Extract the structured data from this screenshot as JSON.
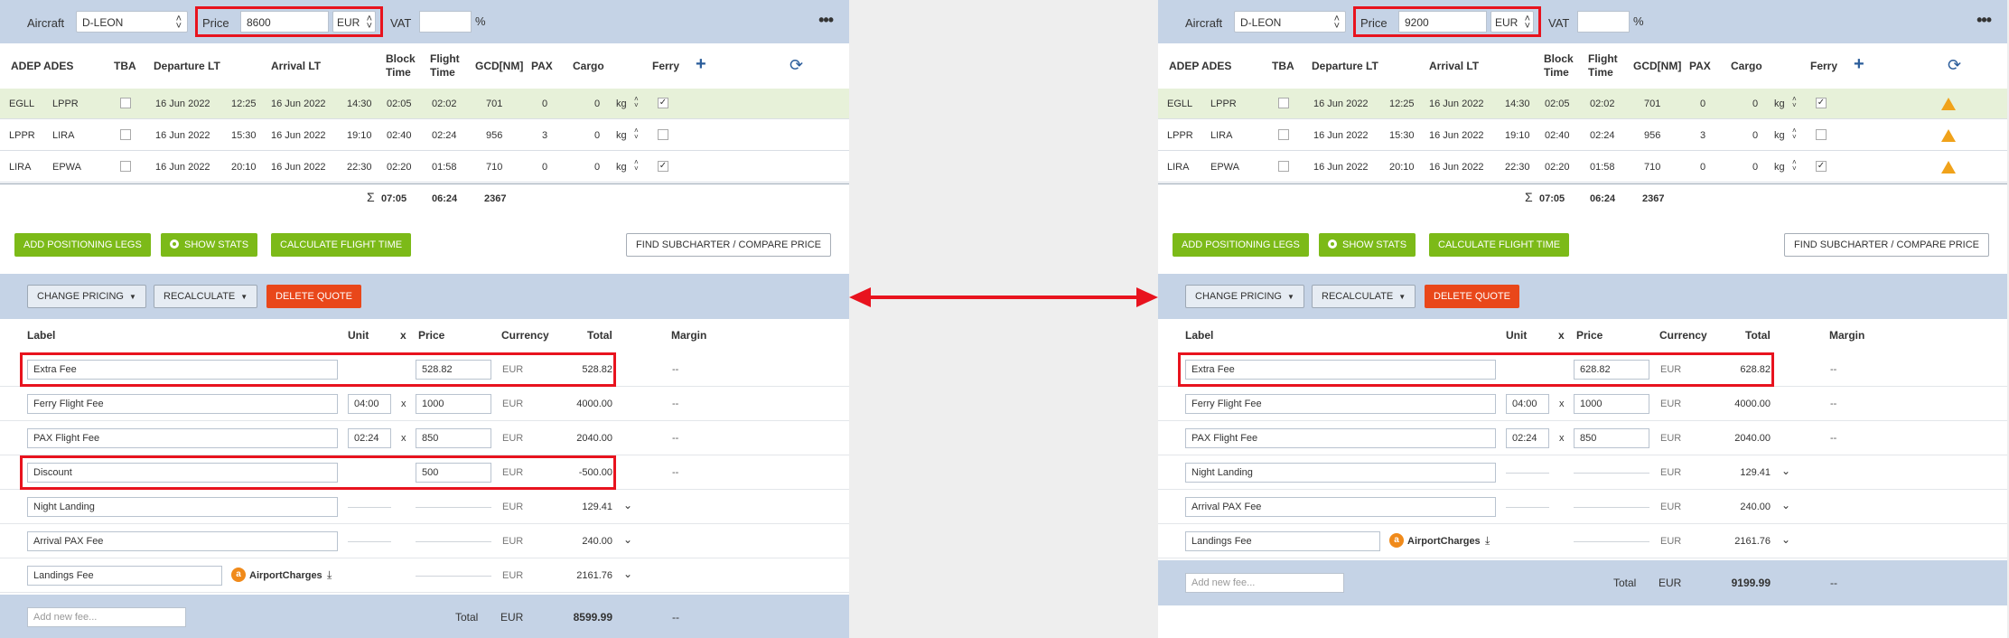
{
  "panels": [
    {
      "aircraft_label": "Aircraft",
      "aircraft_value": "D-LEON",
      "price_label": "Price",
      "price_value": "8600",
      "currency": "EUR",
      "vat_label": "VAT",
      "vat_value": "",
      "vat_unit": "%",
      "columns": [
        "ADEP",
        "ADES",
        "TBA",
        "Departure LT",
        "Arrival LT",
        "Block Time",
        "Flight Time",
        "GCD[NM]",
        "PAX",
        "Cargo",
        "Ferry"
      ],
      "legs": [
        {
          "adep": "EGLL",
          "ades": "LPPR",
          "dep_date": "16 Jun 2022",
          "dep_time": "12:25",
          "arr_date": "16 Jun 2022",
          "arr_time": "14:30",
          "block": "02:05",
          "flight": "02:02",
          "gcd": "701",
          "pax": "0",
          "cargo": "0",
          "unit": "kg",
          "ferry": true,
          "highlight": true,
          "warning": false
        },
        {
          "adep": "LPPR",
          "ades": "LIRA",
          "dep_date": "16 Jun 2022",
          "dep_time": "15:30",
          "arr_date": "16 Jun 2022",
          "arr_time": "19:10",
          "block": "02:40",
          "flight": "02:24",
          "gcd": "956",
          "pax": "3",
          "cargo": "0",
          "unit": "kg",
          "ferry": false,
          "highlight": false,
          "warning": false
        },
        {
          "adep": "LIRA",
          "ades": "EPWA",
          "dep_date": "16 Jun 2022",
          "dep_time": "20:10",
          "arr_date": "16 Jun 2022",
          "arr_time": "22:30",
          "block": "02:20",
          "flight": "01:58",
          "gcd": "710",
          "pax": "0",
          "cargo": "0",
          "unit": "kg",
          "ferry": true,
          "highlight": false,
          "warning": false
        }
      ],
      "totals": {
        "sigma": "Σ",
        "block": "07:05",
        "flight": "06:24",
        "gcd": "2367"
      },
      "buttons": {
        "positioning": "ADD POSITIONING LEGS",
        "stats": "SHOW STATS",
        "calc": "CALCULATE FLIGHT TIME",
        "subcharter": "FIND SUBCHARTER / COMPARE PRICE"
      },
      "pricing": {
        "change": "CHANGE PRICING",
        "recalc": "RECALCULATE",
        "delete": "DELETE QUOTE"
      },
      "fee_headers": [
        "Label",
        "Unit",
        "x",
        "Price",
        "Currency",
        "Total",
        "Margin"
      ],
      "fees": [
        {
          "label": "Extra Fee",
          "unit": "",
          "x": "",
          "price": "528.82",
          "currency": "EUR",
          "total": "528.82",
          "margin": "--",
          "type": "input",
          "boxed": true
        },
        {
          "label": "Ferry Flight Fee",
          "unit": "04:00",
          "x": "x",
          "price": "1000",
          "currency": "EUR",
          "total": "4000.00",
          "margin": "--",
          "type": "input",
          "boxed": false
        },
        {
          "label": "PAX Flight Fee",
          "unit": "02:24",
          "x": "x",
          "price": "850",
          "currency": "EUR",
          "total": "2040.00",
          "margin": "--",
          "type": "input",
          "boxed": false
        },
        {
          "label": "Discount",
          "unit": "",
          "x": "",
          "price": "500",
          "currency": "EUR",
          "total": "-500.00",
          "margin": "--",
          "type": "input",
          "boxed": true
        },
        {
          "label": "Night Landing",
          "unit": "",
          "x": "",
          "price": "",
          "currency": "EUR",
          "total": "129.41",
          "margin": "",
          "type": "computed",
          "boxed": false
        },
        {
          "label": "Arrival PAX Fee",
          "unit": "",
          "x": "",
          "price": "",
          "currency": "EUR",
          "total": "240.00",
          "margin": "",
          "type": "computed",
          "boxed": false
        },
        {
          "label": "Landings Fee",
          "unit": "",
          "x": "",
          "price": "",
          "currency": "EUR",
          "total": "2161.76",
          "margin": "",
          "type": "airport",
          "boxed": false
        }
      ],
      "airport_charges": "AirportCharges",
      "new_fee_placeholder": "Add new fee...",
      "total_label": "Total",
      "total_currency": "EUR",
      "total_value": "8599.99",
      "total_margin": "--"
    },
    {
      "aircraft_label": "Aircraft",
      "aircraft_value": "D-LEON",
      "price_label": "Price",
      "price_value": "9200",
      "currency": "EUR",
      "vat_label": "VAT",
      "vat_value": "",
      "vat_unit": "%",
      "columns": [
        "ADEP",
        "ADES",
        "TBA",
        "Departure LT",
        "Arrival LT",
        "Block Time",
        "Flight Time",
        "GCD[NM]",
        "PAX",
        "Cargo",
        "Ferry"
      ],
      "legs": [
        {
          "adep": "EGLL",
          "ades": "LPPR",
          "dep_date": "16 Jun 2022",
          "dep_time": "12:25",
          "arr_date": "16 Jun 2022",
          "arr_time": "14:30",
          "block": "02:05",
          "flight": "02:02",
          "gcd": "701",
          "pax": "0",
          "cargo": "0",
          "unit": "kg",
          "ferry": true,
          "highlight": true,
          "warning": true
        },
        {
          "adep": "LPPR",
          "ades": "LIRA",
          "dep_date": "16 Jun 2022",
          "dep_time": "15:30",
          "arr_date": "16 Jun 2022",
          "arr_time": "19:10",
          "block": "02:40",
          "flight": "02:24",
          "gcd": "956",
          "pax": "3",
          "cargo": "0",
          "unit": "kg",
          "ferry": false,
          "highlight": false,
          "warning": true
        },
        {
          "adep": "LIRA",
          "ades": "EPWA",
          "dep_date": "16 Jun 2022",
          "dep_time": "20:10",
          "arr_date": "16 Jun 2022",
          "arr_time": "22:30",
          "block": "02:20",
          "flight": "01:58",
          "gcd": "710",
          "pax": "0",
          "cargo": "0",
          "unit": "kg",
          "ferry": true,
          "highlight": false,
          "warning": true
        }
      ],
      "totals": {
        "sigma": "Σ",
        "block": "07:05",
        "flight": "06:24",
        "gcd": "2367"
      },
      "buttons": {
        "positioning": "ADD POSITIONING LEGS",
        "stats": "SHOW STATS",
        "calc": "CALCULATE FLIGHT TIME",
        "subcharter": "FIND SUBCHARTER / COMPARE PRICE"
      },
      "pricing": {
        "change": "CHANGE PRICING",
        "recalc": "RECALCULATE",
        "delete": "DELETE QUOTE"
      },
      "fee_headers": [
        "Label",
        "Unit",
        "x",
        "Price",
        "Currency",
        "Total",
        "Margin"
      ],
      "fees": [
        {
          "label": "Extra Fee",
          "unit": "",
          "x": "",
          "price": "628.82",
          "currency": "EUR",
          "total": "628.82",
          "margin": "--",
          "type": "input",
          "boxed": true
        },
        {
          "label": "Ferry Flight Fee",
          "unit": "04:00",
          "x": "x",
          "price": "1000",
          "currency": "EUR",
          "total": "4000.00",
          "margin": "--",
          "type": "input",
          "boxed": false
        },
        {
          "label": "PAX Flight Fee",
          "unit": "02:24",
          "x": "x",
          "price": "850",
          "currency": "EUR",
          "total": "2040.00",
          "margin": "--",
          "type": "input",
          "boxed": false
        },
        {
          "label": "Night Landing",
          "unit": "",
          "x": "",
          "price": "",
          "currency": "EUR",
          "total": "129.41",
          "margin": "",
          "type": "computed",
          "boxed": false
        },
        {
          "label": "Arrival PAX Fee",
          "unit": "",
          "x": "",
          "price": "",
          "currency": "EUR",
          "total": "240.00",
          "margin": "",
          "type": "computed",
          "boxed": false
        },
        {
          "label": "Landings Fee",
          "unit": "",
          "x": "",
          "price": "",
          "currency": "EUR",
          "total": "2161.76",
          "margin": "",
          "type": "airport",
          "boxed": false
        }
      ],
      "airport_charges": "AirportCharges",
      "new_fee_placeholder": "Add new fee...",
      "total_label": "Total",
      "total_currency": "EUR",
      "total_value": "9199.99",
      "total_margin": "--"
    }
  ],
  "colors": {
    "accent_green": "#7cba18",
    "danger_red": "#e9471a",
    "highlight_border": "#e8131e",
    "header_bg": "#c5d3e6",
    "warning": "#f0a21a"
  }
}
